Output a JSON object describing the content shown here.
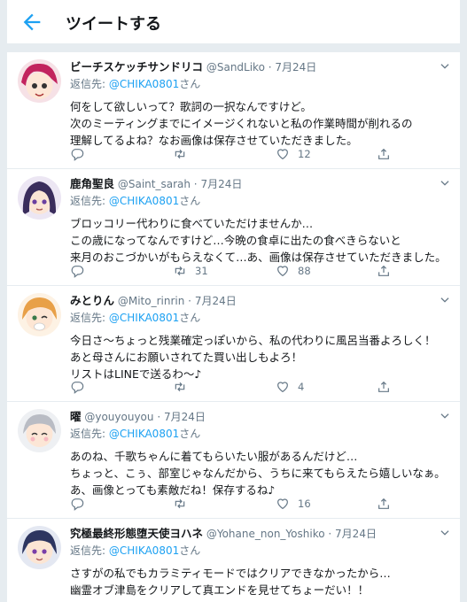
{
  "header": {
    "title": "ツイートする"
  },
  "reply_prefix": "返信先:",
  "tweets": [
    {
      "name": "ビーチスケッチサンドリコ",
      "handle": "@SandLiko",
      "date": "7月24日",
      "reply_to": "@CHIKA0801",
      "reply_suffix": "さん",
      "lines": [
        "何をして欲しいって？歌詞の一択なんですけど。",
        "次のミーティングまでにイメージくれないと私の作業時間が削れるの",
        "理解してるよね？なお画像は保存させていただきました。"
      ],
      "replies": "",
      "retweets": "",
      "likes": "12"
    },
    {
      "name": "鹿角聖良",
      "handle": "@Saint_sarah",
      "date": "7月24日",
      "reply_to": "@CHIKA0801",
      "reply_suffix": "さん",
      "lines": [
        "ブロッコリー代わりに食べていただけませんか…",
        "この歳になってなんですけど…今晩の食卓に出たの食べきらないと",
        "来月のおこづかいがもらえなくて…あ、画像は保存させていただきました。"
      ],
      "replies": "",
      "retweets": "31",
      "likes": "88"
    },
    {
      "name": "みとりん",
      "handle": "@Mito_rinrin",
      "date": "7月24日",
      "reply_to": "@CHIKA0801",
      "reply_suffix": "さん",
      "lines": [
        "今日さ〜ちょっと残業確定っぽいから、私の代わりに風呂当番よろしく！",
        "あと母さんにお願いされてた買い出しもよろ！",
        "リストはLINEで送るわ〜♪"
      ],
      "replies": "",
      "retweets": "",
      "likes": "4"
    },
    {
      "name": "曜",
      "handle": "@youyouyou",
      "date": "7月24日",
      "reply_to": "@CHIKA0801",
      "reply_suffix": "さん",
      "lines": [
        "あのね、千歌ちゃんに着てもらいたい服があるんだけど…",
        "ちょっと、こぅ、部室じゃなんだから、うちに来てもらえたら嬉しいなぁ。",
        "あ、画像とっても素敵だね！保存するね♪"
      ],
      "replies": "",
      "retweets": "",
      "likes": "16"
    },
    {
      "name": "究極最終形態堕天使ヨハネ",
      "handle": "@Yohane_non_Yoshiko",
      "date": "7月24日",
      "reply_to": "@CHIKA0801",
      "reply_suffix": "さん",
      "lines": [
        "さすがの私でもカラミティモードではクリアできなかったから…",
        "幽霊オブ津島をクリアして真エンドを見せてちょーだい！！"
      ],
      "replies": "",
      "retweets": "",
      "likes": ""
    }
  ],
  "colors": {
    "accent": "#1da1f2",
    "muted": "#657786",
    "divider": "#e6ecf0",
    "text": "#14171a"
  },
  "icons": {
    "back": "back-arrow-icon",
    "reply": "reply-icon",
    "retweet": "retweet-icon",
    "like": "heart-icon",
    "share": "share-icon",
    "menu": "chevron-down-icon"
  }
}
